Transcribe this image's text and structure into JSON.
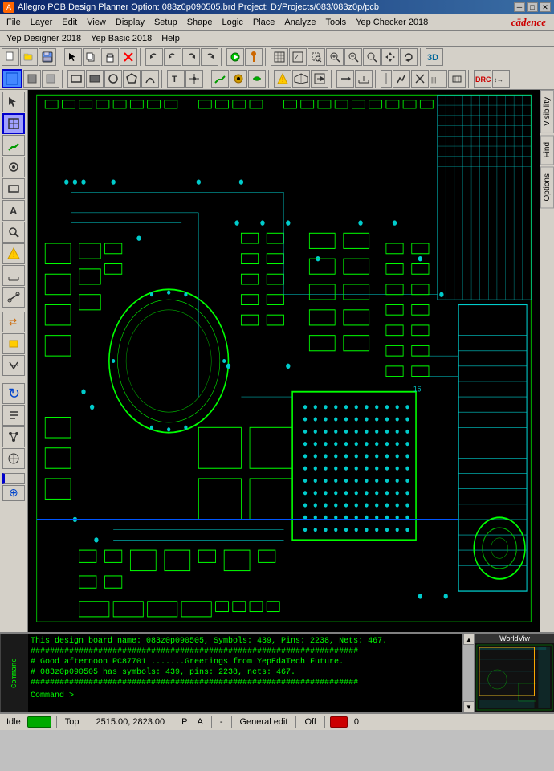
{
  "titlebar": {
    "title": "Allegro PCB Design Planner Option: 083z0p090505.brd  Project: D:/Projects/083/083z0p/pcb",
    "icon": "A",
    "minimize": "─",
    "maximize": "□",
    "close": "✕"
  },
  "menubar1": {
    "items": [
      "File",
      "Layer",
      "Edit",
      "View",
      "Display",
      "Setup",
      "Shape",
      "Logic",
      "Place",
      "Analyze",
      "Tools",
      "Yep Checker 2018"
    ],
    "logo": "cādence"
  },
  "menubar2": {
    "items": [
      "Yep Designer 2018",
      "Yep Basic 2018",
      "Help"
    ]
  },
  "rightpanel": {
    "tabs": [
      "Visibility",
      "Find",
      "Options"
    ]
  },
  "console": {
    "lines": [
      "This design board name: 083z0p090505, Symbols: 439, Pins: 2238, Nets: 467.",
      "####################################################################",
      "# Good afternoon PC87701      .......Greetings from YepEdaTech Future.",
      "# 083z0p090505 has symbols: 439, pins: 2238, nets: 467.",
      "####################################################################"
    ],
    "prompt": "Command >"
  },
  "minimap": {
    "label": "WorldViw"
  },
  "statusbar": {
    "idle": "Idle",
    "layer": "Top",
    "coords": "2515.00, 2823.00",
    "pa": "P",
    "pa2": "A",
    "dash": "-",
    "mode": "General edit",
    "off": "Off",
    "num": "0"
  }
}
